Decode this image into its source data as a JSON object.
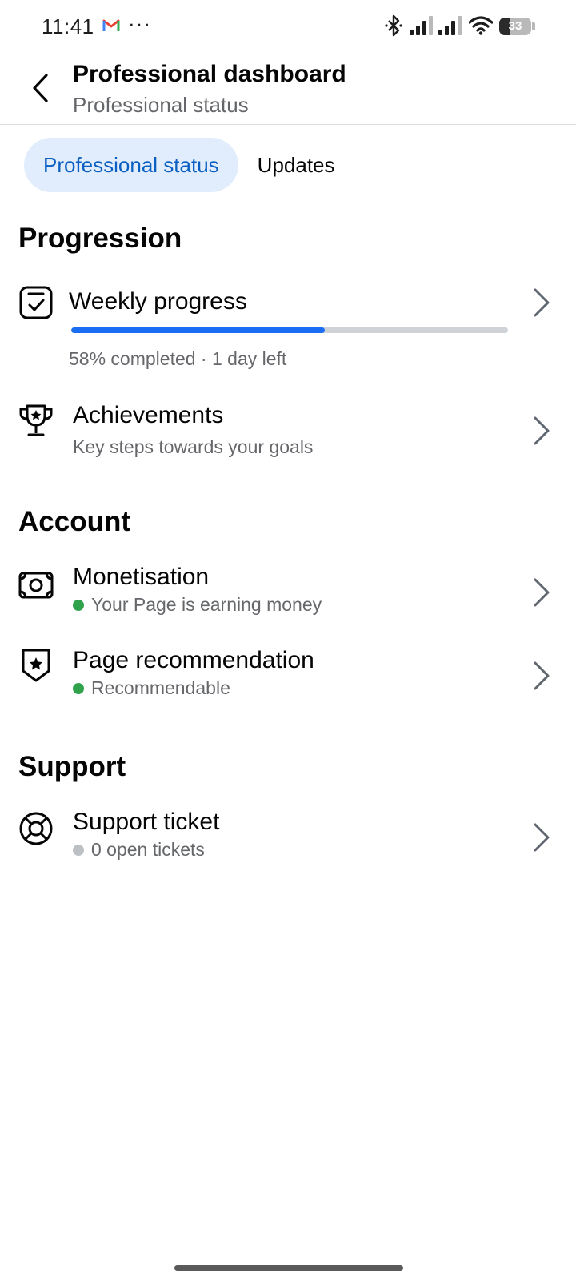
{
  "status_bar": {
    "time": "11:41",
    "more": "···",
    "battery_level": "33",
    "battery_fraction": 0.33,
    "icons": [
      "gmail-icon",
      "bluetooth-icon",
      "signal-icon",
      "signal-icon",
      "wifi-icon",
      "battery-icon"
    ]
  },
  "header": {
    "title": "Professional dashboard",
    "subtitle": "Professional status"
  },
  "tabs": [
    {
      "label": "Professional status",
      "active": true
    },
    {
      "label": "Updates",
      "active": false
    }
  ],
  "sections": {
    "progression": {
      "title": "Progression",
      "weekly_progress": {
        "title": "Weekly progress",
        "progress": 0.58,
        "status": "58% completed · 1 day left"
      },
      "achievements": {
        "title": "Achievements",
        "subtitle": "Key steps towards your goals"
      }
    },
    "account": {
      "title": "Account",
      "monetisation": {
        "title": "Monetisation",
        "status": "Your Page is earning money",
        "status_color": "#31a24c"
      },
      "page_recommendation": {
        "title": "Page recommendation",
        "status": "Recommendable",
        "status_color": "#31a24c"
      }
    },
    "support": {
      "title": "Support",
      "support_ticket": {
        "title": "Support ticket",
        "status": "0 open tickets",
        "status_color": "#bcc0c4"
      }
    }
  },
  "colors": {
    "accent": "#1b6ef3",
    "tab_active_bg": "#e1edfc",
    "tab_active_text": "#0a60c2",
    "secondary_text": "#65676b"
  }
}
